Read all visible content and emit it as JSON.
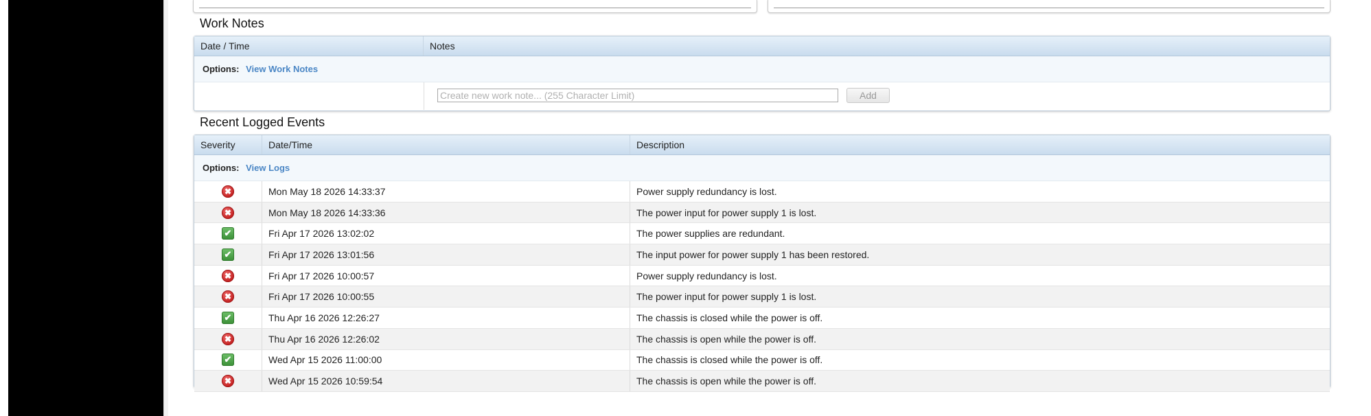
{
  "work_notes": {
    "title": "Work Notes",
    "columns": [
      "Date / Time",
      "Notes"
    ],
    "options_label": "Options:",
    "options_link": "View Work Notes",
    "input_placeholder": "Create new work note... (255 Character Limit)",
    "add_label": "Add"
  },
  "events": {
    "title": "Recent Logged Events",
    "columns": [
      "Severity",
      "Date/Time",
      "Description"
    ],
    "options_label": "Options:",
    "options_link": "View Logs",
    "rows": [
      {
        "severity": "error",
        "datetime": "Mon May 18 2026 14:33:37",
        "description": "Power supply redundancy is lost."
      },
      {
        "severity": "error",
        "datetime": "Mon May 18 2026 14:33:36",
        "description": "The power input for power supply 1 is lost."
      },
      {
        "severity": "ok",
        "datetime": "Fri Apr 17 2026 13:02:02",
        "description": "The power supplies are redundant."
      },
      {
        "severity": "ok",
        "datetime": "Fri Apr 17 2026 13:01:56",
        "description": "The input power for power supply 1 has been restored."
      },
      {
        "severity": "error",
        "datetime": "Fri Apr 17 2026 10:00:57",
        "description": "Power supply redundancy is lost."
      },
      {
        "severity": "error",
        "datetime": "Fri Apr 17 2026 10:00:55",
        "description": "The power input for power supply 1 is lost."
      },
      {
        "severity": "ok",
        "datetime": "Thu Apr 16 2026 12:26:27",
        "description": "The chassis is closed while the power is off."
      },
      {
        "severity": "error",
        "datetime": "Thu Apr 16 2026 12:26:02",
        "description": "The chassis is open while the power is off."
      },
      {
        "severity": "ok",
        "datetime": "Wed Apr 15 2026 11:00:00",
        "description": "The chassis is closed while the power is off."
      },
      {
        "severity": "error",
        "datetime": "Wed Apr 15 2026 10:59:54",
        "description": "The chassis is open while the power is off."
      }
    ]
  },
  "icons": {
    "error": "error-icon",
    "ok": "ok-check-icon"
  },
  "colors": {
    "link": "#4a86c5",
    "header_gradient_top": "#e6f0f9",
    "header_gradient_bottom": "#c9dcee",
    "error": "#c31f1f",
    "ok": "#3a8e36"
  }
}
